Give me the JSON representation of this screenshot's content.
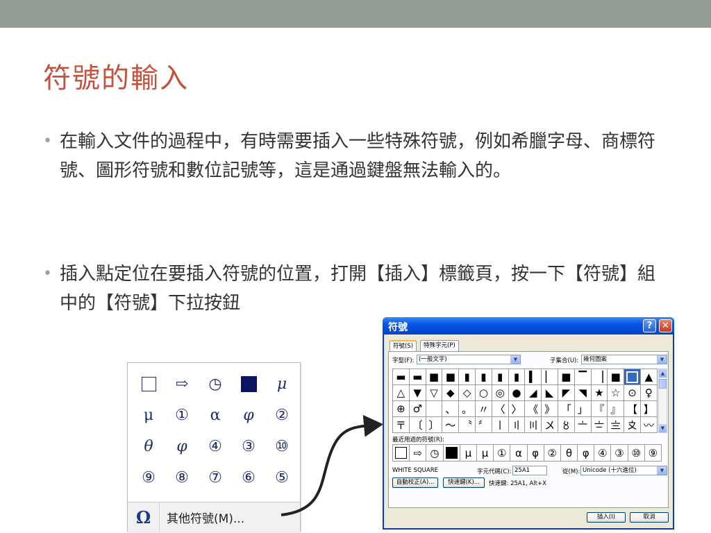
{
  "slide": {
    "title": "符號的輸入",
    "bullets": [
      "在輸入文件的過程中，有時需要插入一些特殊符號，例如希臘字母、商標符號、圖形符號和數位記號等，這是通過鍵盤無法輸入的。",
      "插入點定位在要插入符號的位置，打開【插入】標籤頁，按一下【符號】組中的【符號】下拉按鈕"
    ],
    "bullet_marker": "•",
    "colors": {
      "title": "#c2533d",
      "band": "#949b95",
      "text": "#333333"
    }
  },
  "gallery": {
    "symbols": [
      "",
      "⇨",
      "◷",
      "",
      "μ",
      "μ",
      "①",
      "α",
      "φ",
      "②",
      "θ",
      "φ",
      "④",
      "③",
      "⑩",
      "⑨",
      "⑧",
      "⑦",
      "⑥",
      "⑤"
    ],
    "omega_icon": "Ω",
    "more_label": "其他符號(M)..."
  },
  "dialog": {
    "title": "符號",
    "help_glyph": "?",
    "close_glyph": "✕",
    "tabs": [
      "符號(S)",
      "特殊字元(P)"
    ],
    "font_label": "字型(F):",
    "font_value": "(一般文字)",
    "subset_label": "子集合(U):",
    "subset_value": "幾何圖案",
    "symbols": [
      "▬",
      "▬",
      "■",
      "■",
      "▮",
      "▮",
      "▮",
      "▮",
      "▍",
      "▏",
      "■",
      "▔",
      "▕",
      "■",
      "",
      "▲",
      "△",
      "▼",
      "▽",
      "◆",
      "◇",
      "○",
      "◎",
      "●",
      "◢",
      "◣",
      "◤",
      "◥",
      "★",
      "☆",
      "⊙",
      "♀",
      "⊕",
      "♂",
      "",
      "、",
      "。",
      "〃",
      "〈",
      "〉",
      "《",
      "》",
      "「",
      "」",
      "『",
      "』",
      "【",
      "】",
      "〒",
      "〔",
      "〕",
      "～",
      "〝",
      "〞",
      "〡",
      "〢",
      "〣",
      "〤",
      "〥",
      "〦",
      "〧",
      "〨",
      "〩",
      "〰"
    ],
    "recent_label": "最近用過的符號(R):",
    "recent": [
      "",
      "⇨",
      "◷",
      "",
      "μ",
      "μ",
      "①",
      "α",
      "φ",
      "②",
      "θ",
      "φ",
      "④",
      "③",
      "⑩",
      "⑨"
    ],
    "char_name": "WHITE SQUARE",
    "code_label": "字元代碼(C):",
    "code_value": "25A1",
    "from_label": "從(M):",
    "from_value": "Unicode (十六進位)",
    "autocorrect_button": "自動校正(A)...",
    "shortcut_button": "快速鍵(K)...",
    "shortcut_text": "快速鍵: 25A1, Alt+X",
    "insert_button": "插入(I)",
    "cancel_button": "取消"
  }
}
